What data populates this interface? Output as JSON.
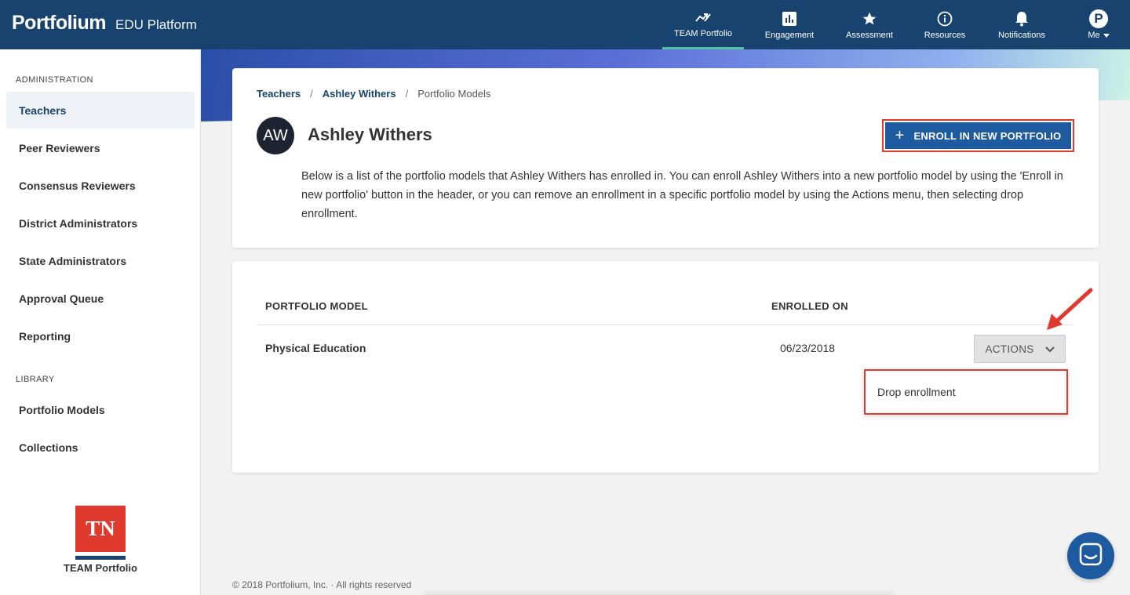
{
  "brand": {
    "logo": "Portfolium",
    "subtitle": "EDU Platform"
  },
  "nav": [
    {
      "label": "TEAM Portfolio",
      "icon": "team-portfolio-icon"
    },
    {
      "label": "Engagement",
      "icon": "bar-chart-icon"
    },
    {
      "label": "Assessment",
      "icon": "star-icon"
    },
    {
      "label": "Resources",
      "icon": "info-icon"
    },
    {
      "label": "Notifications",
      "icon": "bell-icon"
    },
    {
      "label": "Me",
      "avatar": "P",
      "icon": "caret-down-icon"
    }
  ],
  "sidebar": {
    "admin_heading": "ADMINISTRATION",
    "admin_items": [
      "Teachers",
      "Peer Reviewers",
      "Consensus Reviewers",
      "District Administrators",
      "State Administrators",
      "Approval Queue",
      "Reporting"
    ],
    "library_heading": "LIBRARY",
    "library_items": [
      "Portfolio Models",
      "Collections"
    ],
    "logo_text": "TN",
    "logo_caption": "TEAM Portfolio"
  },
  "breadcrumb": {
    "first": "Teachers",
    "second": "Ashley Withers",
    "current": "Portfolio Models",
    "sep": "/"
  },
  "profile": {
    "initials": "AW",
    "name": "Ashley Withers",
    "description": "Below is a list of the portfolio models that Ashley Withers has enrolled in. You can enroll Ashley Withers into a new portfolio model by using the 'Enroll in new portfolio' button in the header, or you can remove an enrollment in a specific portfolio model by using the Actions menu, then selecting drop enrollment."
  },
  "enroll_button": {
    "label": "ENROLL IN NEW PORTFOLIO",
    "plus": "+"
  },
  "table": {
    "headers": {
      "model": "PORTFOLIO MODEL",
      "enrolled": "ENROLLED ON"
    },
    "rows": [
      {
        "model": "Physical Education",
        "enrolled": "06/23/2018"
      }
    ],
    "actions_label": "ACTIONS",
    "dropdown_item": "Drop enrollment"
  },
  "footer": "© 2018 Portfolium, Inc. · All rights reserved",
  "colors": {
    "navy": "#18436e",
    "accent_blue": "#1e5aa0",
    "highlight_red": "#e03a2f",
    "teal": "#4fc3a1"
  }
}
